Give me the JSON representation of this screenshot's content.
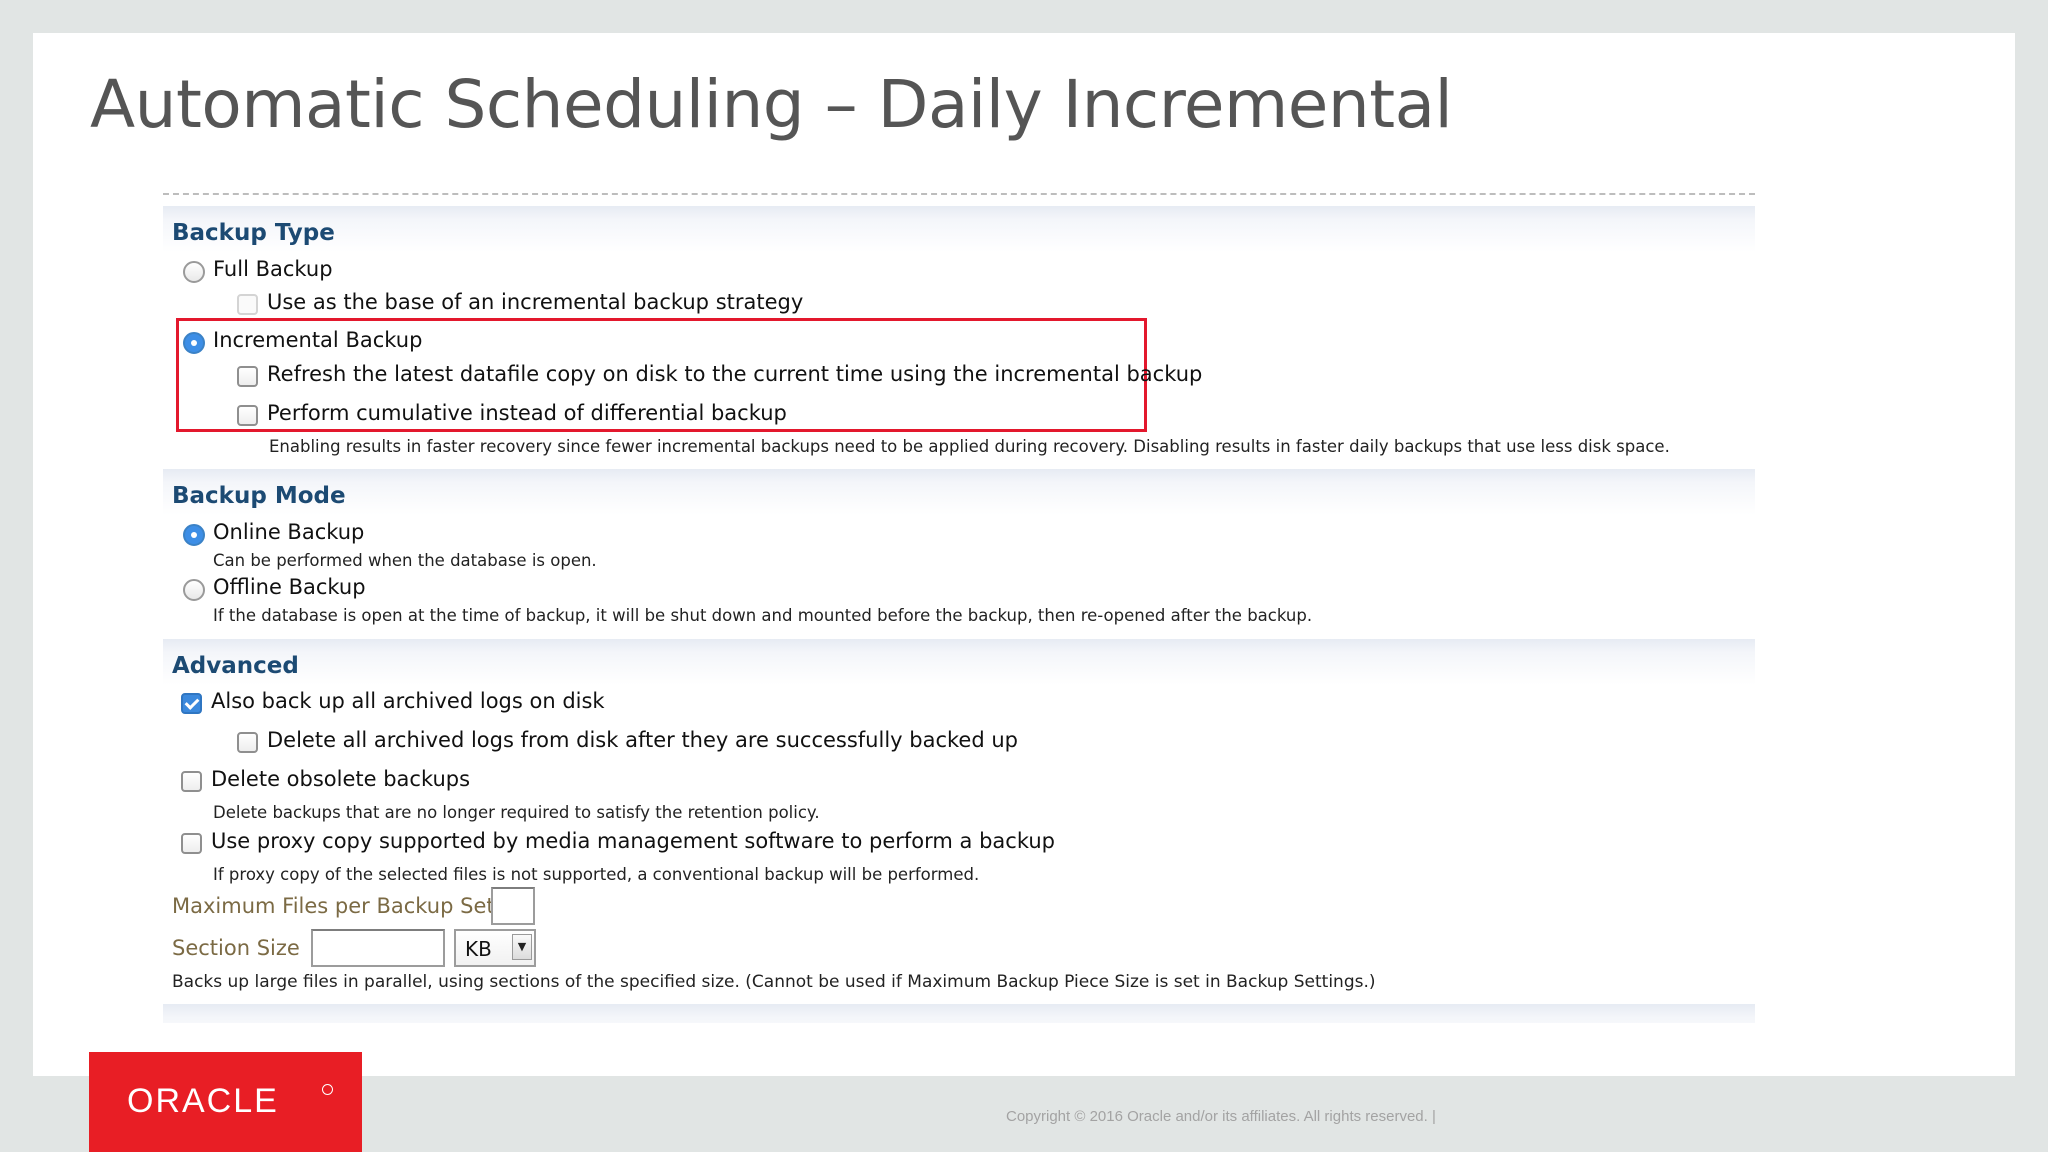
{
  "slide": {
    "title": "Automatic Scheduling – Daily Incremental",
    "copyright": "Copyright © 2016 Oracle and/or its affiliates. All rights reserved.  |",
    "logo_text": "ORACLE"
  },
  "backup_type": {
    "heading": "Backup Type",
    "full_backup": {
      "label": "Full Backup",
      "selected": false
    },
    "full_base_option": {
      "label": "Use as the base of an incremental backup strategy",
      "checked": false,
      "disabled": true
    },
    "incremental_backup": {
      "label": "Incremental Backup",
      "selected": true
    },
    "refresh_option": {
      "label": "Refresh the latest datafile copy on disk to the current time using the incremental backup",
      "checked": false
    },
    "cumulative_option": {
      "label": "Perform cumulative instead of differential backup",
      "checked": false
    },
    "cumulative_note": "Enabling results in faster recovery since fewer incremental backups need to be applied during recovery. Disabling results in faster daily backups that use less disk space."
  },
  "backup_mode": {
    "heading": "Backup Mode",
    "online": {
      "label": "Online Backup",
      "selected": true,
      "note": "Can be performed when the database is open."
    },
    "offline": {
      "label": "Offline Backup",
      "selected": false,
      "note": "If the database is open at the time of backup, it will be shut down and mounted before the backup, then re-opened after the backup."
    }
  },
  "advanced": {
    "heading": "Advanced",
    "archived_logs": {
      "label": "Also back up all archived logs on disk",
      "checked": true
    },
    "delete_archived": {
      "label": "Delete all archived logs from disk after they are successfully backed up",
      "checked": false
    },
    "delete_obsolete": {
      "label": "Delete obsolete backups",
      "checked": false,
      "note": "Delete backups that are no longer required to satisfy the retention policy."
    },
    "proxy_copy": {
      "label": "Use proxy copy supported by media management software to perform a backup",
      "checked": false,
      "note": "If proxy copy of the selected files is not supported, a conventional backup will be performed."
    },
    "max_files": {
      "label": "Maximum Files per Backup Set",
      "value": ""
    },
    "section_size": {
      "label": "Section Size",
      "value": "",
      "unit": "KB",
      "note": "Backs up large files in parallel, using sections of the specified size. (Cannot be used if Maximum Backup Piece Size is set in Backup Settings.)"
    }
  },
  "colors": {
    "highlight_border": "#e3182d",
    "section_heading": "#1c4a73",
    "oracle_red": "#e81e25"
  }
}
